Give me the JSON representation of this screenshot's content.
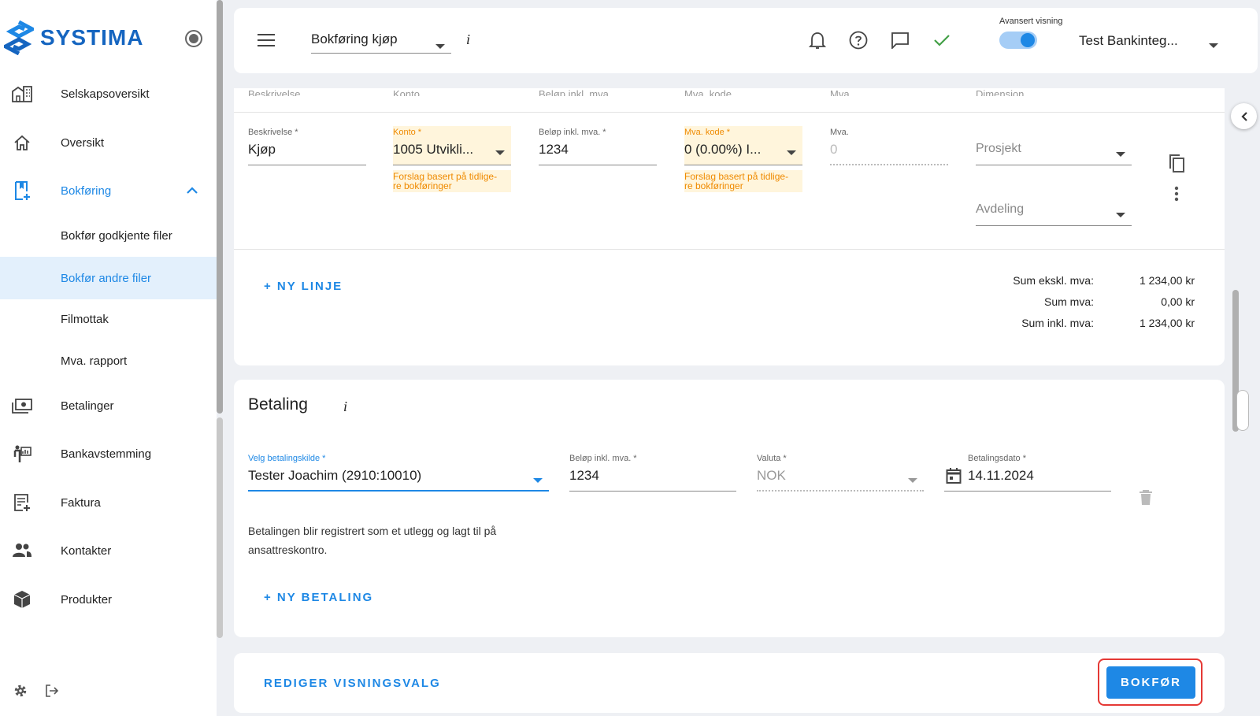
{
  "sidebar": {
    "brand": "SYSTIMA",
    "items": [
      {
        "label": "Selskapsoversikt",
        "icon": "building-icon"
      },
      {
        "label": "Oversikt",
        "icon": "home-icon"
      },
      {
        "label": "Bokføring",
        "icon": "bookkeeping-icon"
      },
      {
        "label": "Betalinger",
        "icon": "payments-icon"
      },
      {
        "label": "Bankavstemming",
        "icon": "bank-reconcile-icon"
      },
      {
        "label": "Faktura",
        "icon": "invoice-icon"
      },
      {
        "label": "Kontakter",
        "icon": "contacts-icon"
      },
      {
        "label": "Produkter",
        "icon": "products-icon"
      }
    ],
    "sub_items": [
      "Bokfør godkjente filer",
      "Bokfør andre filer",
      "Filmottak",
      "Mva. rapport"
    ]
  },
  "topbar": {
    "doc_type": "Bokføring kjøp",
    "info": "i",
    "toggle_label": "Avansert visning",
    "toggle_on": true,
    "company": "Test Bankinteg..."
  },
  "lines": {
    "headers": [
      "Beskrivelse",
      "Konto",
      "Beløp inkl. mva.",
      "Mva. kode",
      "Mva.",
      "Dimensjon"
    ],
    "row": {
      "beskrivelse_label": "Beskrivelse *",
      "beskrivelse": "Kjøp",
      "konto_label": "Konto *",
      "konto": "1005 Utvikli...",
      "konto_hint": "Forslag basert på tidlige-\nre bokføringer",
      "belop_label": "Beløp inkl. mva. *",
      "belop": "1234",
      "mvakode_label": "Mva. kode *",
      "mvakode": "0 (0.00%) I...",
      "mvakode_hint": "Forslag basert på tidlige-\nre bokføringer",
      "mva_label": "Mva.",
      "mva": "0",
      "prosjekt": "Prosjekt",
      "avdeling": "Avdeling"
    },
    "new_line": "+ NY LINJE",
    "sums": [
      {
        "label": "Sum ekskl. mva:",
        "value": "1 234,00 kr"
      },
      {
        "label": "Sum mva:",
        "value": "0,00 kr"
      },
      {
        "label": "Sum inkl. mva:",
        "value": "1 234,00 kr"
      }
    ]
  },
  "payment": {
    "title": "Betaling",
    "info": "i",
    "source_label": "Velg betalingskilde *",
    "source": "Tester Joachim (2910:10010)",
    "amount_label": "Beløp inkl. mva. *",
    "amount": "1234",
    "currency_label": "Valuta *",
    "currency": "NOK",
    "date_label": "Betalingsdato *",
    "date": "14.11.2024",
    "note": "Betalingen blir registrert som et utlegg og lagt til på ansattreskontro.",
    "new_payment": "+ NY BETALING"
  },
  "footer": {
    "edit_view": "REDIGER VISNINGSVALG",
    "submit": "BOKFØR"
  },
  "colors": {
    "accent": "#1e88e5",
    "suggestion": "#ef8a00",
    "highlight": "#e53935"
  }
}
